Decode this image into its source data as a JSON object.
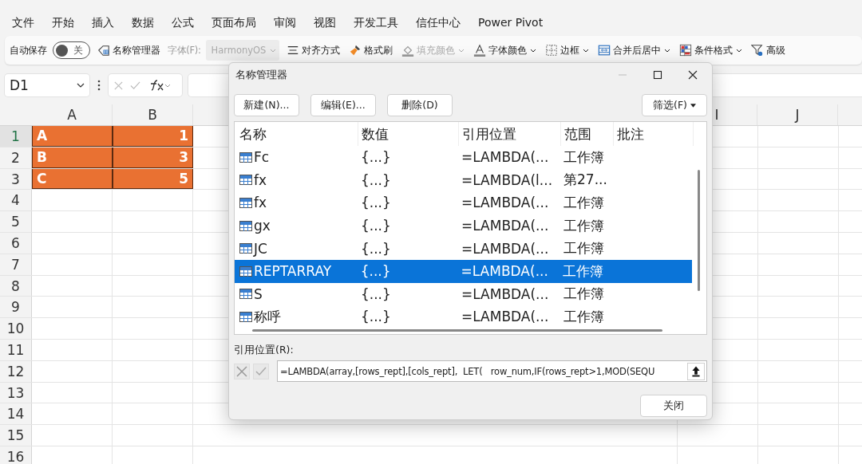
{
  "menu_tabs": [
    "文件",
    "开始",
    "插入",
    "数据",
    "公式",
    "页面布局",
    "审阅",
    "视图",
    "开发工具",
    "信任中心",
    "Power Pivot"
  ],
  "toolbar": {
    "autosave": {
      "label": "自动保存",
      "on": false,
      "state_text": "关"
    },
    "items": [
      {
        "kind": "namemanager",
        "label": "名称管理器",
        "disabled": false,
        "dropdown": false
      },
      {
        "kind": "font",
        "label": "字体(F):",
        "value": "HarmonyOS",
        "disabled": true,
        "dropdown": true
      },
      {
        "kind": "align",
        "label": "对齐方式",
        "disabled": false,
        "dropdown": false
      },
      {
        "kind": "painter",
        "label": "格式刷",
        "disabled": false,
        "dropdown": false
      },
      {
        "kind": "fill",
        "label": "填充颜色",
        "disabled": true,
        "dropdown": true
      },
      {
        "kind": "fontcolor",
        "label": "字体颜色",
        "disabled": false,
        "dropdown": true
      },
      {
        "kind": "border",
        "label": "边框",
        "disabled": false,
        "dropdown": true
      },
      {
        "kind": "merge",
        "label": "合并后居中",
        "disabled": false,
        "dropdown": true
      },
      {
        "kind": "conditional",
        "label": "条件格式",
        "disabled": false,
        "dropdown": true
      },
      {
        "kind": "advanced",
        "label": "高级",
        "disabled": false,
        "dropdown": false
      }
    ]
  },
  "formula_bar": {
    "name_box": "D1"
  },
  "sheet": {
    "columns": [
      "A",
      "B",
      "I",
      "J"
    ],
    "row_numbers": [
      "1",
      "2",
      "3",
      "4",
      "5",
      "6",
      "7",
      "8",
      "9",
      "10",
      "11",
      "12",
      "13",
      "14",
      "15",
      "16"
    ],
    "data": [
      [
        "A",
        "1"
      ],
      [
        "B",
        "3"
      ],
      [
        "C",
        "5"
      ]
    ]
  },
  "dialog": {
    "title": "名称管理器",
    "buttons": [
      "新建(N)...",
      "编辑(E)...",
      "删除(D)"
    ],
    "filter_button": "筛选(F)",
    "columns": [
      "名称",
      "数值",
      "引用位置",
      "范围",
      "批注"
    ],
    "names": [
      {
        "name": "Fc",
        "value": "{...}",
        "refers_to": "=LAMBDA(...",
        "scope": "工作簿",
        "selected": false
      },
      {
        "name": "fx",
        "value": "{...}",
        "refers_to": "=LAMBDA(l...",
        "scope": "第27...",
        "selected": false
      },
      {
        "name": "fx",
        "value": "{...}",
        "refers_to": "=LAMBDA(...",
        "scope": "工作簿",
        "selected": false
      },
      {
        "name": "gx",
        "value": "{...}",
        "refers_to": "=LAMBDA(...",
        "scope": "工作簿",
        "selected": false
      },
      {
        "name": "JC",
        "value": "{...}",
        "refers_to": "=LAMBDA(...",
        "scope": "工作簿",
        "selected": false
      },
      {
        "name": "REPTARRAY",
        "value": "{...}",
        "refers_to": "=LAMBDA(...",
        "scope": "工作簿",
        "selected": true
      },
      {
        "name": "S",
        "value": "{...}",
        "refers_to": "=LAMBDA(...",
        "scope": "工作簿",
        "selected": false
      },
      {
        "name": "称呼",
        "value": "{...}",
        "refers_to": "=LAMBDA(...",
        "scope": "工作簿",
        "selected": false
      }
    ],
    "refers_to_label": "引用位置(R):",
    "refers_to_value": "=LAMBDA(array,[rows_rept],[cols_rept],  LET(   row_num,IF(rows_rept>1,MOD(SEQU",
    "close_button": "关闭"
  }
}
